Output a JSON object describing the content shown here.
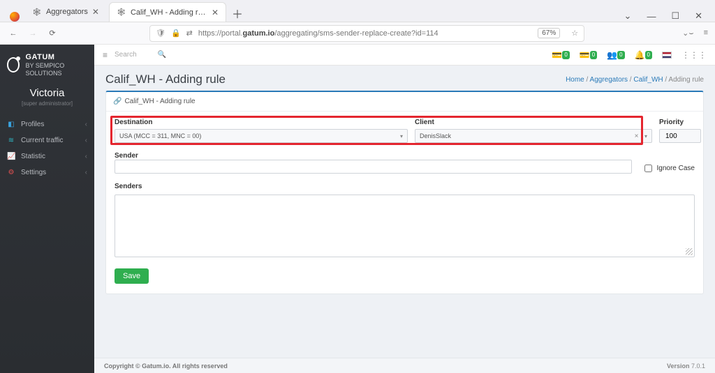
{
  "browser": {
    "tabs": [
      {
        "title": "Aggregators",
        "active": false
      },
      {
        "title": "Calif_WH - Adding rule",
        "active": true
      }
    ],
    "url_prefix": "https://portal.",
    "url_host": "gatum.io",
    "url_path": "/aggregating/sms-sender-replace-create?id=114",
    "zoom": "67%"
  },
  "brand": {
    "name": "GATUM",
    "sub": "BY SEMPICO SOLUTIONS"
  },
  "user": {
    "name": "Victoria",
    "role": "[super administrator]"
  },
  "nav": {
    "profiles": "Profiles",
    "traffic": "Current traffic",
    "statistic": "Statistic",
    "settings": "Settings"
  },
  "topbar": {
    "search_placeholder": "Search",
    "badges": [
      "0",
      "0",
      "0",
      "0"
    ]
  },
  "breadcrumb": {
    "home": "Home",
    "aggregators": "Aggregators",
    "item": "Calif_WH",
    "current": "Adding rule"
  },
  "page": {
    "title": "Calif_WH - Adding rule",
    "panel_title": "Calif_WH - Adding rule"
  },
  "form": {
    "destination_label": "Destination",
    "destination_value": "USA (MCC = 311, MNC = 00)",
    "client_label": "Client",
    "client_value": "DenisSlack",
    "priority_label": "Priority",
    "priority_value": "100",
    "sender_label": "Sender",
    "ignore_case_label": "Ignore Case",
    "senders_label": "Senders",
    "save_label": "Save"
  },
  "footer": {
    "copyright": "Copyright © Gatum.io. All rights reserved",
    "version_label": "Version",
    "version_value": "7.0.1"
  }
}
